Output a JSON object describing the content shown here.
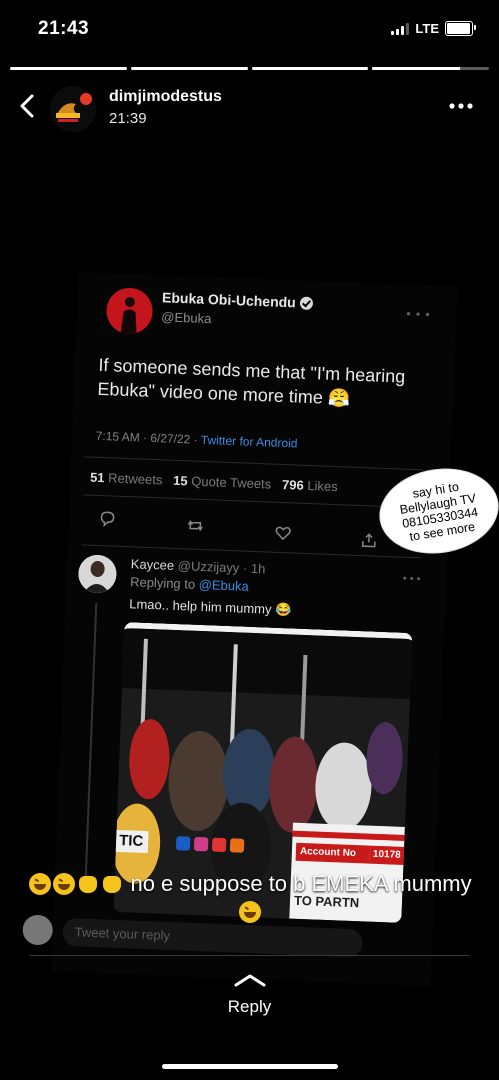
{
  "status_bar": {
    "time": "21:43",
    "network": "LTE",
    "signal_bars": 3,
    "battery_level": 0.95
  },
  "story": {
    "segments": [
      1,
      1,
      1,
      0.75
    ]
  },
  "header": {
    "username": "dimjimodestus",
    "time": "21:39",
    "back_icon": "chevron-left-icon",
    "more_icon": "more-horizontal-icon"
  },
  "tweet": {
    "author_name": "Ebuka Obi-Uchendu",
    "handle": "@Ebuka",
    "text": "If someone sends me that \"I'm hearing Ebuka\" video one more time 😤",
    "timestamp": "7:15 AM · 6/27/22 · ",
    "via": "Twitter for Android",
    "retweets": "51",
    "retweets_label": "Retweets",
    "quote_tweets": "15",
    "quote_tweets_label": "Quote Tweets",
    "likes": "796",
    "likes_label": "Likes",
    "actions": [
      "reply-icon",
      "retweet-icon",
      "like-icon",
      "share-icon"
    ]
  },
  "reply_tweet": {
    "author_name": "Kaycee",
    "handle": "@Uzzijayy · 1h",
    "replying_prefix": "Replying to ",
    "replying_to": "@Ebuka",
    "text": "Lmao.. help him mummy 😂",
    "video": {
      "tic": "TIC",
      "account_label": "Account No",
      "account_number": "10178",
      "partner_text": "TO PARTN"
    }
  },
  "tweet_reply_box": {
    "placeholder": "Tweet your reply"
  },
  "sticker": {
    "lines": [
      "say hi to",
      "Bellylaugh TV",
      "08105330344",
      "to see more"
    ]
  },
  "caption": {
    "text": " no e suppose to b EMEKA mummy",
    "leading_emojis": [
      "laugh",
      "laugh",
      "hands",
      "hands"
    ],
    "trailing_emoji": "laugh"
  },
  "reply": {
    "label": "Reply",
    "icon": "chevron-up-icon"
  }
}
